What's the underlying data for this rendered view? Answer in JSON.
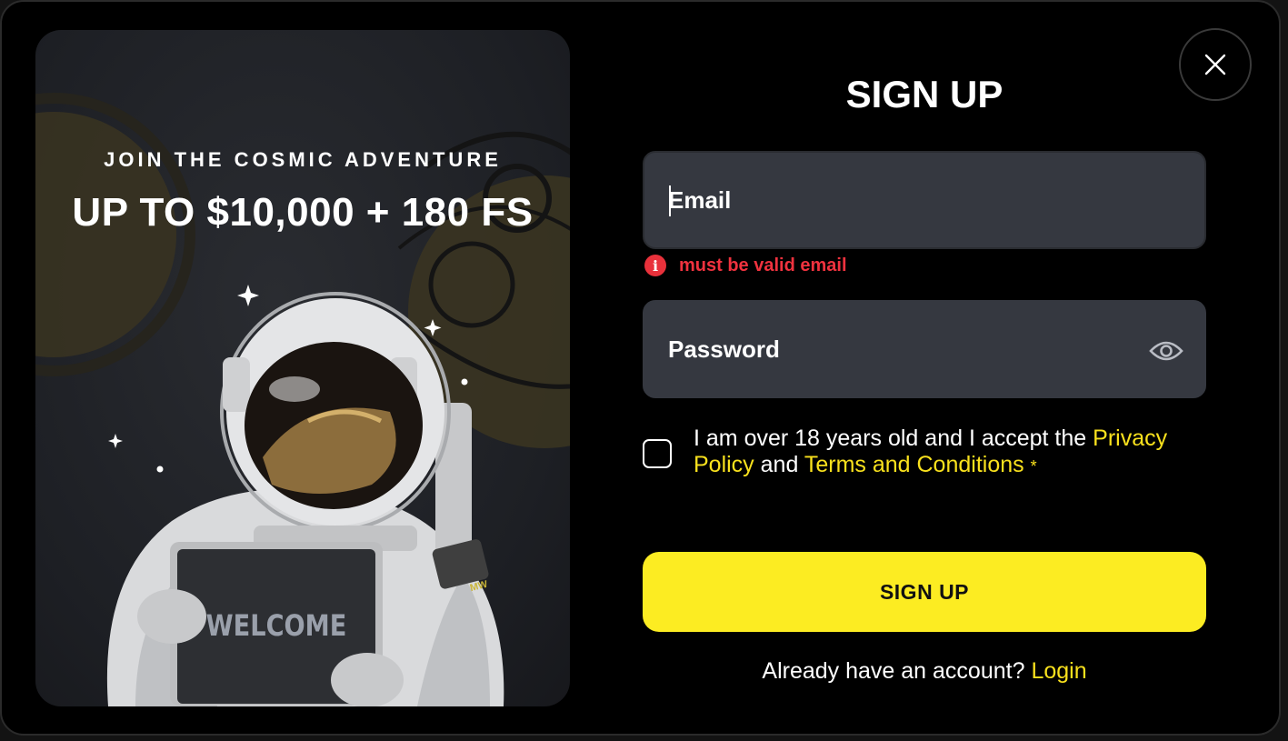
{
  "promo": {
    "kicker": "JOIN THE COSMIC ADVENTURE",
    "headline": "UP TO $10,000 + 180 FS",
    "sign_text": "WELCOME",
    "patch_text": "MW"
  },
  "form": {
    "title": "SIGN UP",
    "email_placeholder": "Email",
    "email_error": "must be valid email",
    "password_placeholder": "Password",
    "consent": {
      "prefix": "I am over 18 years old and I accept the ",
      "privacy_link": "Privacy Policy",
      "middle": " and ",
      "terms_link": "Terms and Conditions",
      "required_mark": "*"
    },
    "submit_label": "SIGN UP",
    "login_prompt": "Already have an account? ",
    "login_link": "Login"
  },
  "colors": {
    "accent": "#fcec22",
    "error": "#f0323e",
    "field_bg": "#353840",
    "background": "#000000"
  },
  "icons": {
    "close": "close-icon",
    "password_toggle": "eye-icon",
    "error": "info-icon"
  }
}
